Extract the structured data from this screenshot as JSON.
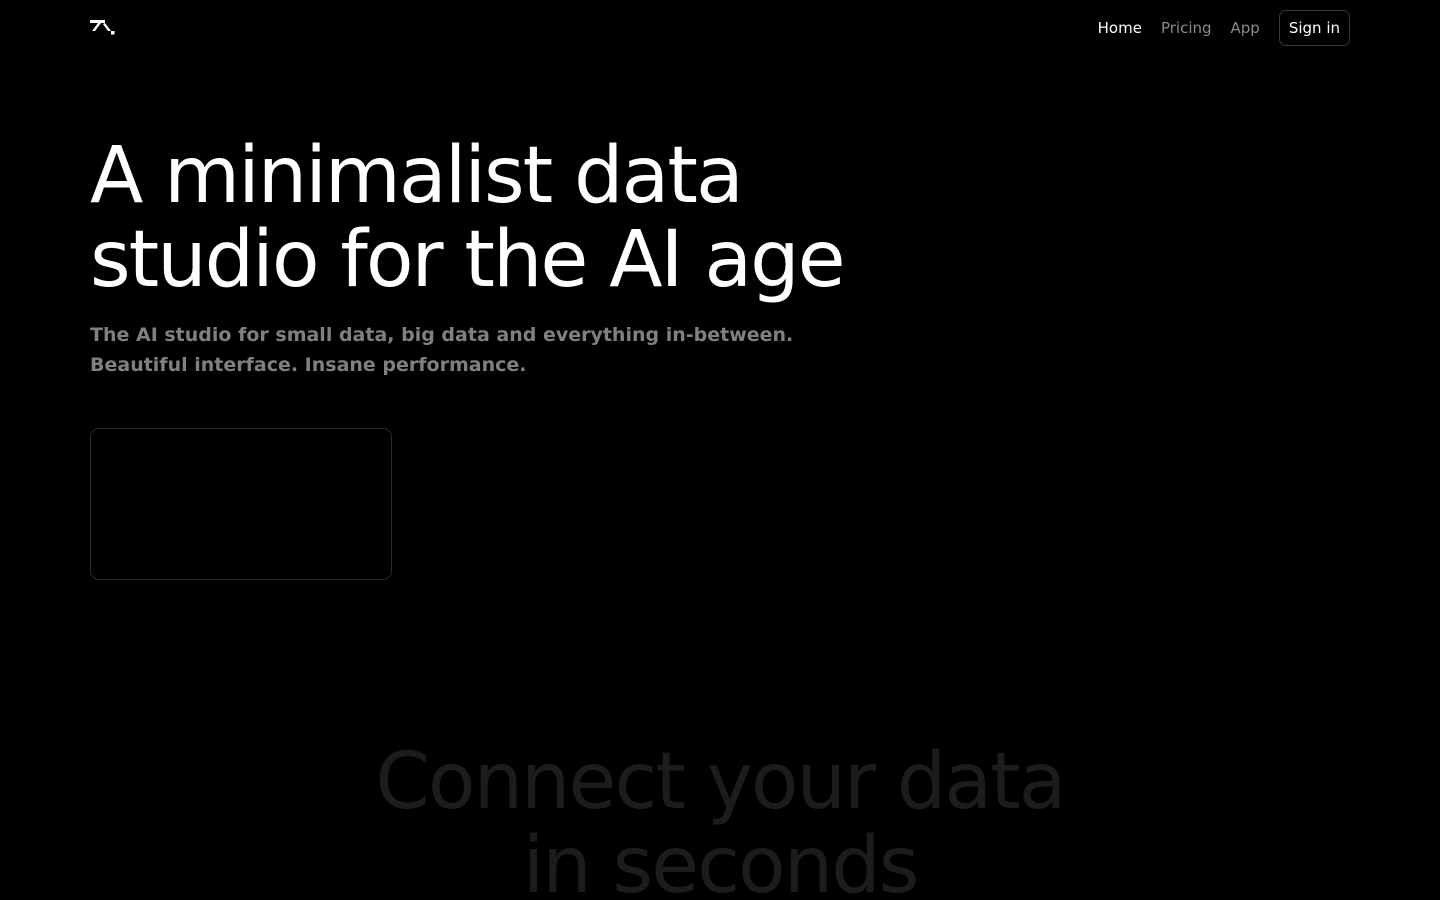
{
  "nav": {
    "logo_icon": "brand-logo-icon",
    "links": [
      {
        "label": "Home",
        "active": true
      },
      {
        "label": "Pricing",
        "active": false
      },
      {
        "label": "App",
        "active": false
      }
    ],
    "signin_label": "Sign in"
  },
  "hero": {
    "title_line1": "A minimalist data",
    "title_line2": "studio for the AI age",
    "subtitle_line1": "The AI studio for small data, big data and everything in-between.",
    "subtitle_line2": "Beautiful interface. Insane performance."
  },
  "section": {
    "title_line1": "Connect your data",
    "title_line2": "in seconds"
  },
  "colors": {
    "background": "#000000",
    "text_primary": "#ffffff",
    "text_muted": "#808080",
    "text_faded": "#1c1c1c",
    "border": "#3a3a3a"
  }
}
